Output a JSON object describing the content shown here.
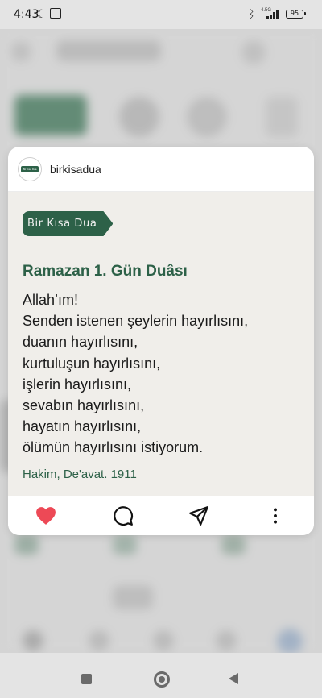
{
  "status_bar": {
    "time": "4:43",
    "network_label": "4.5G",
    "battery": "95"
  },
  "card": {
    "username": "birkisadua",
    "avatar_text": "Bir Kısa Dua",
    "badge": "Bir Kısa Dua",
    "title": "Ramazan 1. Gün Duâsı",
    "body_lines": [
      "Allah’ım!",
      "Senden istenen şeylerin hayırlısını,",
      "duanın hayırlısını,",
      "kurtuluşun hayırlısını,",
      "işlerin hayırlısını,",
      "sevabın hayırlısını,",
      "hayatın hayırlısını,",
      "ölümün hayırlısını istiyorum."
    ],
    "source": "Hakim, De'avat. 1911"
  },
  "actions": {
    "icons": [
      "heart-icon",
      "comment-icon",
      "send-icon",
      "more-icon"
    ],
    "like_color": "#ed4956"
  },
  "colors": {
    "brand_green": "#2d6148",
    "post_background": "#f0eeea"
  }
}
